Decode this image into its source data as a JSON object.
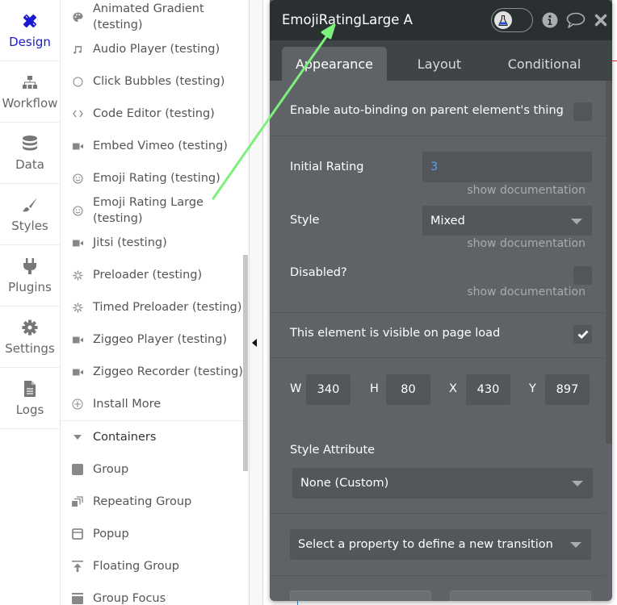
{
  "nav": {
    "items": [
      {
        "label": "Design",
        "icon": "design-icon",
        "active": true
      },
      {
        "label": "Workflow",
        "icon": "workflow-icon",
        "active": false
      },
      {
        "label": "Data",
        "icon": "database-icon",
        "active": false
      },
      {
        "label": "Styles",
        "icon": "brush-icon",
        "active": false
      },
      {
        "label": "Plugins",
        "icon": "plug-icon",
        "active": false
      },
      {
        "label": "Settings",
        "icon": "gear-icon",
        "active": false
      },
      {
        "label": "Logs",
        "icon": "document-icon",
        "active": false
      }
    ],
    "active_color": "#1a1ad2"
  },
  "elements": {
    "plugin_items": [
      {
        "label": "Animated Gradient\n(testing)",
        "icon": "palette-icon"
      },
      {
        "label": "Audio Player (testing)",
        "icon": "music-note-icon"
      },
      {
        "label": "Click Bubbles (testing)",
        "icon": "circle-icon"
      },
      {
        "label": "Code Editor (testing)",
        "icon": "code-icon"
      },
      {
        "label": "Embed Vimeo (testing)",
        "icon": "video-camera-icon"
      },
      {
        "label": "Emoji Rating (testing)",
        "icon": "smiley-icon"
      },
      {
        "label": "Emoji Rating Large\n(testing)",
        "icon": "smiley-icon"
      },
      {
        "label": "Jitsi (testing)",
        "icon": "video-camera-icon"
      },
      {
        "label": "Preloader (testing)",
        "icon": "spinner-icon"
      },
      {
        "label": "Timed Preloader (testing)",
        "icon": "spinner-icon"
      },
      {
        "label": "Ziggeo Player (testing)",
        "icon": "video-camera-icon"
      },
      {
        "label": "Ziggeo Recorder (testing)",
        "icon": "video-camera-icon"
      },
      {
        "label": "Install More",
        "icon": "plus-circle-icon"
      }
    ],
    "containers_header": "Containers",
    "container_items": [
      {
        "label": "Group",
        "icon": "group-icon"
      },
      {
        "label": "Repeating Group",
        "icon": "repeating-group-icon"
      },
      {
        "label": "Popup",
        "icon": "popup-icon"
      },
      {
        "label": "Floating Group",
        "icon": "floating-group-icon"
      },
      {
        "label": "Group Focus",
        "icon": "group-focus-icon"
      }
    ]
  },
  "panel": {
    "title": "EmojiRatingLarge A",
    "header_icons": [
      "flask-icon",
      "info-icon",
      "comment-icon",
      "close-icon"
    ],
    "tabs": [
      {
        "label": "Appearance",
        "active": true
      },
      {
        "label": "Layout",
        "active": false
      },
      {
        "label": "Conditional",
        "active": false
      }
    ],
    "auto_binding": {
      "label": "Enable auto-binding on parent element's thing",
      "checked": false
    },
    "initial_rating": {
      "label": "Initial Rating",
      "value": "3",
      "doc": "show documentation"
    },
    "style": {
      "label": "Style",
      "value": "Mixed",
      "doc": "show documentation"
    },
    "disabled": {
      "label": "Disabled?",
      "checked": false,
      "doc": "show documentation"
    },
    "visible": {
      "label": "This element is visible on page load",
      "checked": true
    },
    "dimensions": {
      "w_label": "W",
      "w": "340",
      "h_label": "H",
      "h": "80",
      "x_label": "X",
      "x": "430",
      "y_label": "Y",
      "y": "897"
    },
    "style_attribute": {
      "label": "Style Attribute",
      "value": "None (Custom)"
    },
    "transition": {
      "placeholder": "Select a property to define a new transition"
    },
    "value_color": "#5b9ef0"
  },
  "annotation": {
    "color": "#7cf07a"
  }
}
